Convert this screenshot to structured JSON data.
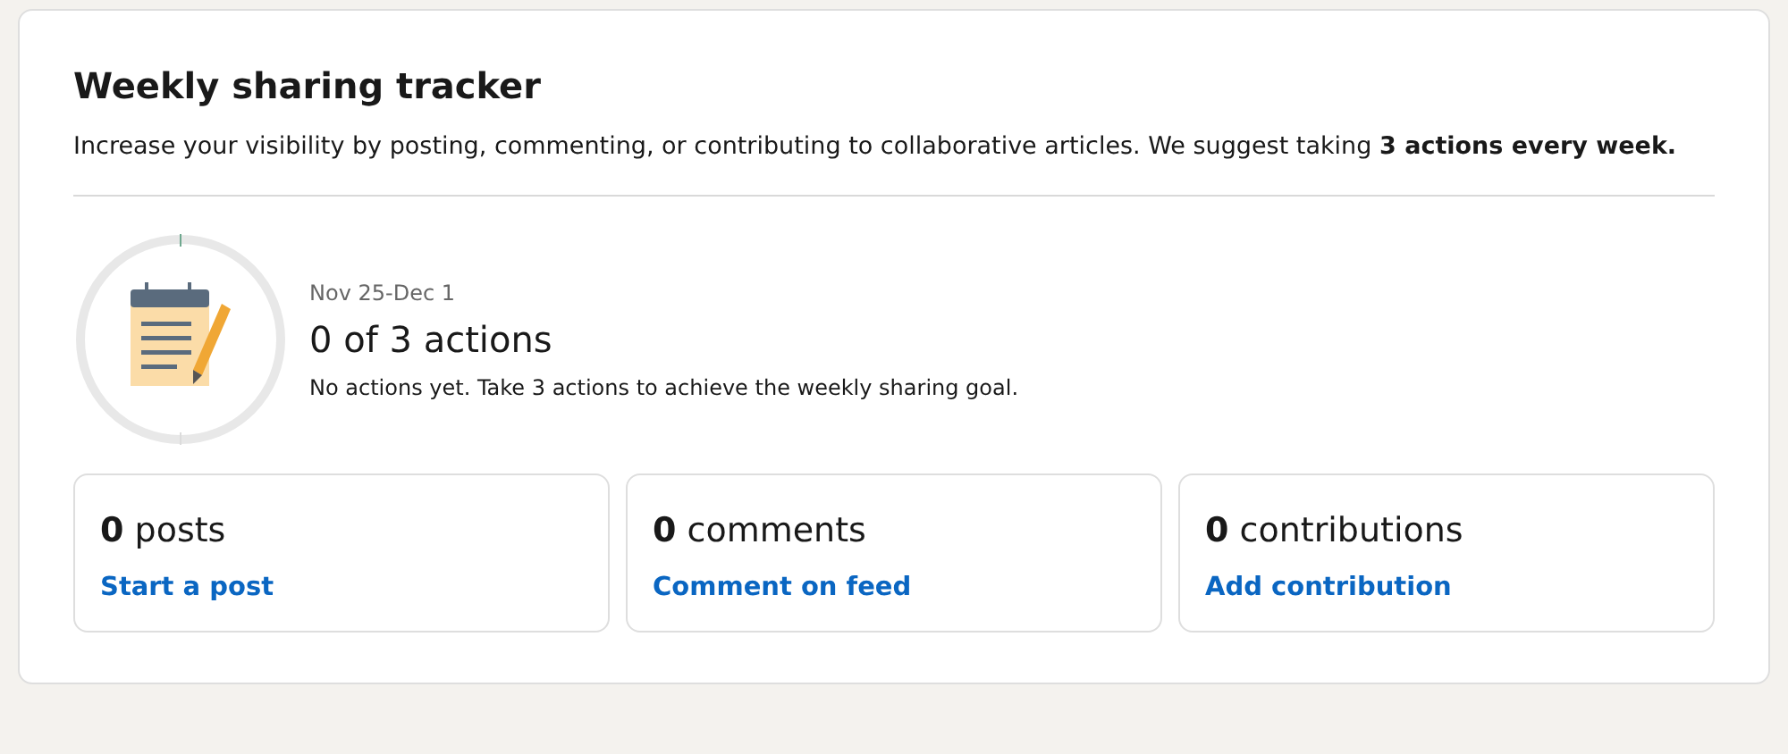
{
  "title": "Weekly sharing tracker",
  "description": "Increase your visibility by posting, commenting, or contributing to collaborative articles. We suggest taking **3 actions every week.**",
  "progress": {
    "level": 0,
    "date_range": "Nov 25-Dec 1",
    "count": "0 of 3",
    "unit": "actions",
    "message": "No actions yet. Take 3 actions to achieve the weekly sharing goal."
  },
  "stats": [
    {
      "count": "0",
      "label": "posts",
      "link": "Start a post"
    },
    {
      "count": "0",
      "label": "comments",
      "link": "Comment on feed"
    },
    {
      "count": "0",
      "label": "contributions",
      "link": "Add contribution"
    }
  ]
}
